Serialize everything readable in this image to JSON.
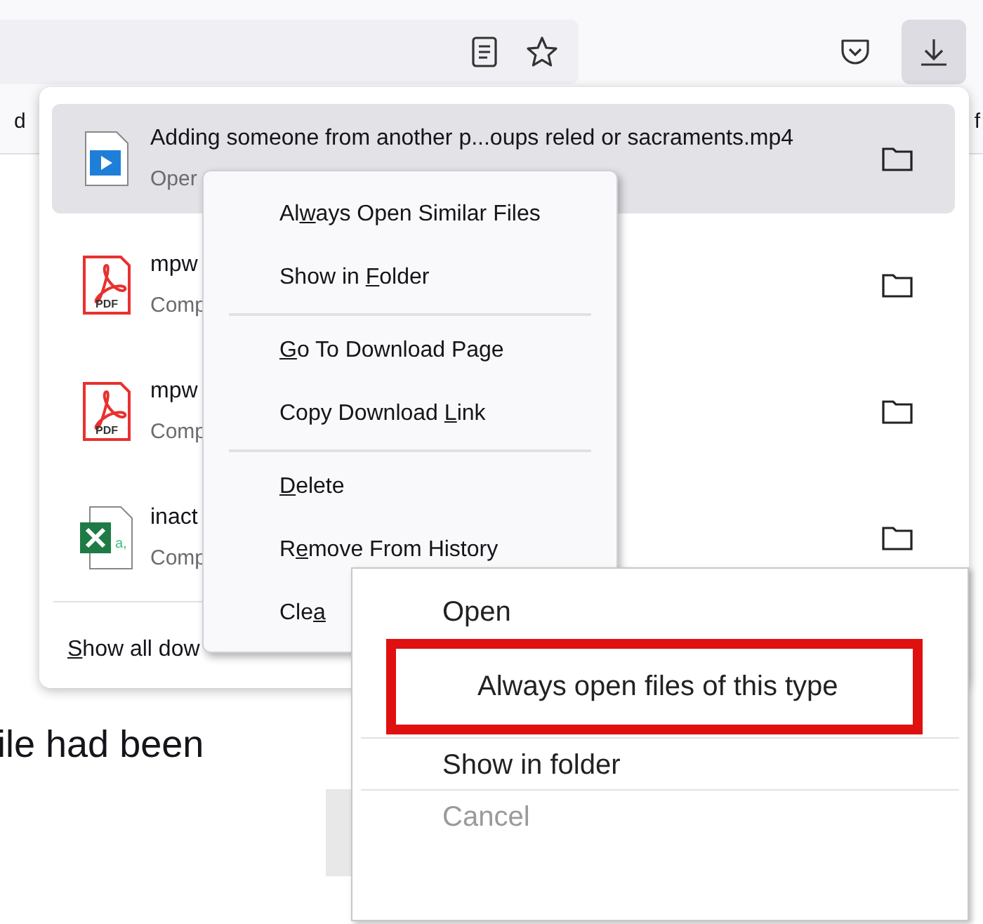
{
  "toolbar": {
    "bookmark_left": "d",
    "bookmark_right": "f"
  },
  "downloads": {
    "items": [
      {
        "kind": "video",
        "name": "Adding someone from another p...oups reled or sacraments.mp4",
        "status": "Oper",
        "selected": true
      },
      {
        "kind": "pdf",
        "icon_text": "PDF",
        "name": "mpw",
        "status": "Comp",
        "selected": false
      },
      {
        "kind": "pdf",
        "icon_text": "PDF",
        "name": "mpw",
        "status": "Comp",
        "selected": false
      },
      {
        "kind": "excel",
        "icon_text": "a,",
        "name": "inact",
        "status": "Comp",
        "selected": false
      }
    ],
    "footer": {
      "key": "S",
      "post": "how all dow"
    }
  },
  "context_menu": {
    "groups": [
      [
        {
          "pre": "Al",
          "key": "w",
          "post": "ays Open Similar Files"
        },
        {
          "pre": "Show in ",
          "key": "F",
          "post": "older"
        }
      ],
      [
        {
          "key": "G",
          "post": "o To Download Page"
        },
        {
          "pre": "Copy Download ",
          "key": "L",
          "post": "ink"
        }
      ],
      [
        {
          "key": "D",
          "post": "elete"
        },
        {
          "pre": "R",
          "key": "e",
          "post": "move From History"
        },
        {
          "pre": "Cle",
          "key": "a"
        }
      ]
    ]
  },
  "caption": "ile had been",
  "system_menu": {
    "groups": [
      [
        {
          "label": "Open",
          "disabled": false,
          "highlighted": false
        },
        {
          "label": "Always open files of this type",
          "disabled": false,
          "highlighted": true
        }
      ],
      [
        {
          "label": "Show in folder",
          "disabled": false,
          "highlighted": false
        }
      ],
      [
        {
          "label": "Cancel",
          "disabled": true,
          "highlighted": false
        }
      ]
    ]
  }
}
